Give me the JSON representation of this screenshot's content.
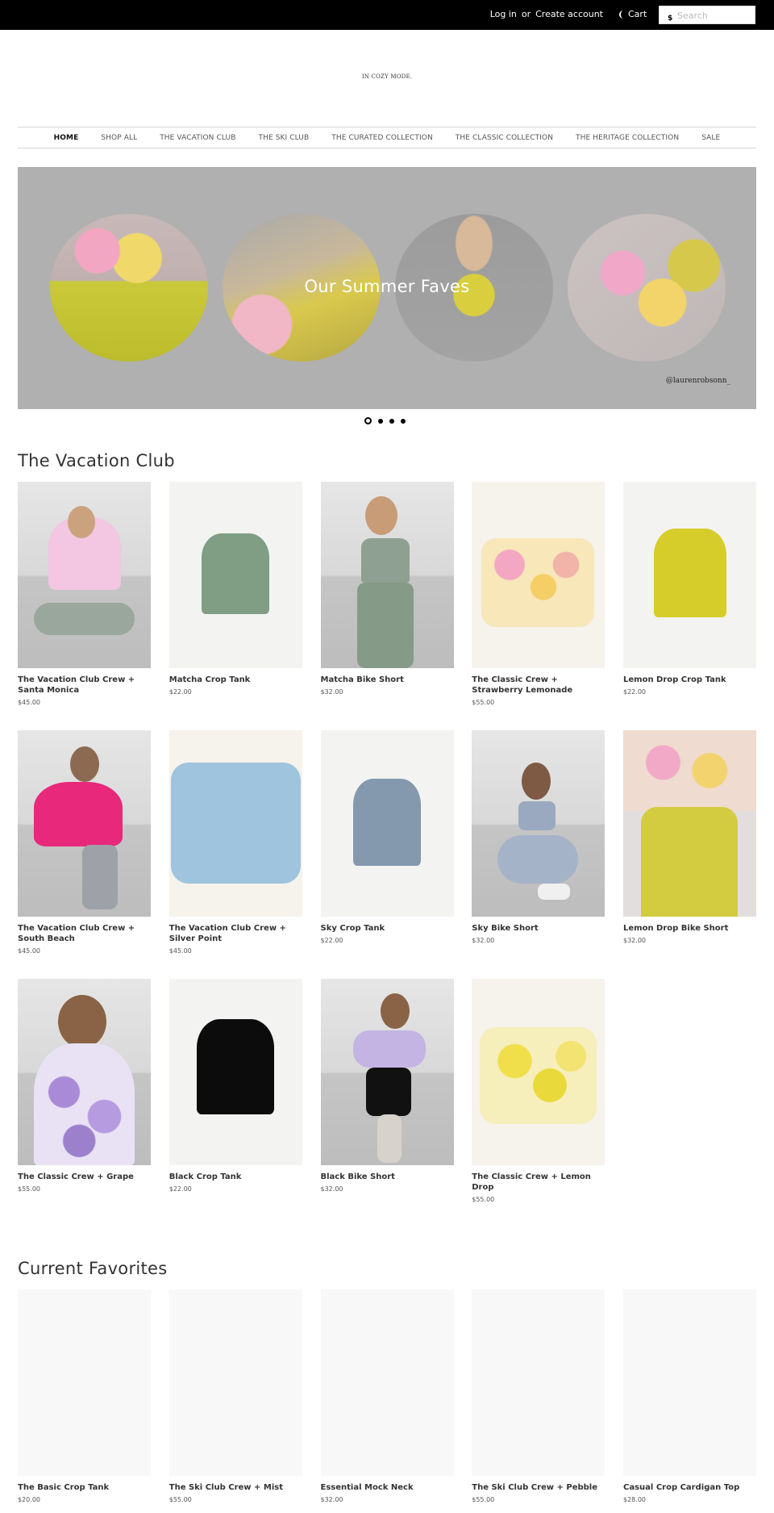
{
  "header": {
    "login_label": "Log in",
    "or_label": "or",
    "create_account_label": "Create account",
    "cart_label": "Cart",
    "search_placeholder": "Search",
    "search_icon_glyph": "$"
  },
  "logo_text": "IN COZY MODE.",
  "nav": {
    "items": [
      {
        "label": "HOME"
      },
      {
        "label": "SHOP ALL"
      },
      {
        "label": "THE VACATION CLUB"
      },
      {
        "label": "THE SKI CLUB"
      },
      {
        "label": "THE CURATED COLLECTION"
      },
      {
        "label": "THE CLASSIC COLLECTION"
      },
      {
        "label": "THE HERITAGE COLLECTION"
      },
      {
        "label": "SALE"
      }
    ]
  },
  "hero": {
    "title": "Our Summer Faves",
    "credit": "@laurenrobsonn_"
  },
  "slider": {
    "slide_count": 4,
    "active_slide": 1
  },
  "vacation_club": {
    "title": "The Vacation Club",
    "products": [
      {
        "name": "The Vacation Club Crew + Santa Monica",
        "price": "$45.00"
      },
      {
        "name": "Matcha Crop Tank",
        "price": "$22.00"
      },
      {
        "name": "Matcha Bike Short",
        "price": "$32.00"
      },
      {
        "name": "The Classic Crew + Strawberry Lemonade",
        "price": "$55.00"
      },
      {
        "name": "Lemon Drop Crop Tank",
        "price": "$22.00"
      },
      {
        "name": "The Vacation Club Crew + South Beach",
        "price": "$45.00"
      },
      {
        "name": "The Vacation Club Crew + Silver Point",
        "price": "$45.00"
      },
      {
        "name": "Sky Crop Tank",
        "price": "$22.00"
      },
      {
        "name": "Sky Bike Short",
        "price": "$32.00"
      },
      {
        "name": "Lemon Drop Bike Short",
        "price": "$32.00"
      },
      {
        "name": "The Classic Crew + Grape",
        "price": "$55.00"
      },
      {
        "name": "Black Crop Tank",
        "price": "$22.00"
      },
      {
        "name": "Black Bike Short",
        "price": "$32.00"
      },
      {
        "name": "The Classic Crew + Lemon Drop",
        "price": "$55.00"
      }
    ]
  },
  "current_favorites": {
    "title": "Current Favorites",
    "products": [
      {
        "name": "The Basic Crop Tank",
        "price": "$20.00"
      },
      {
        "name": "The Ski Club Crew + Mist",
        "price": "$55.00"
      },
      {
        "name": "Essential Mock Neck",
        "price": "$32.00"
      },
      {
        "name": "The Ski Club Crew + Pebble",
        "price": "$55.00"
      },
      {
        "name": "Casual Crop Cardigan Top",
        "price": "$28.00"
      }
    ]
  },
  "colors": {
    "topbar_bg": "#000000",
    "hero_bg": "#b0b0b0",
    "text": "#333333"
  }
}
